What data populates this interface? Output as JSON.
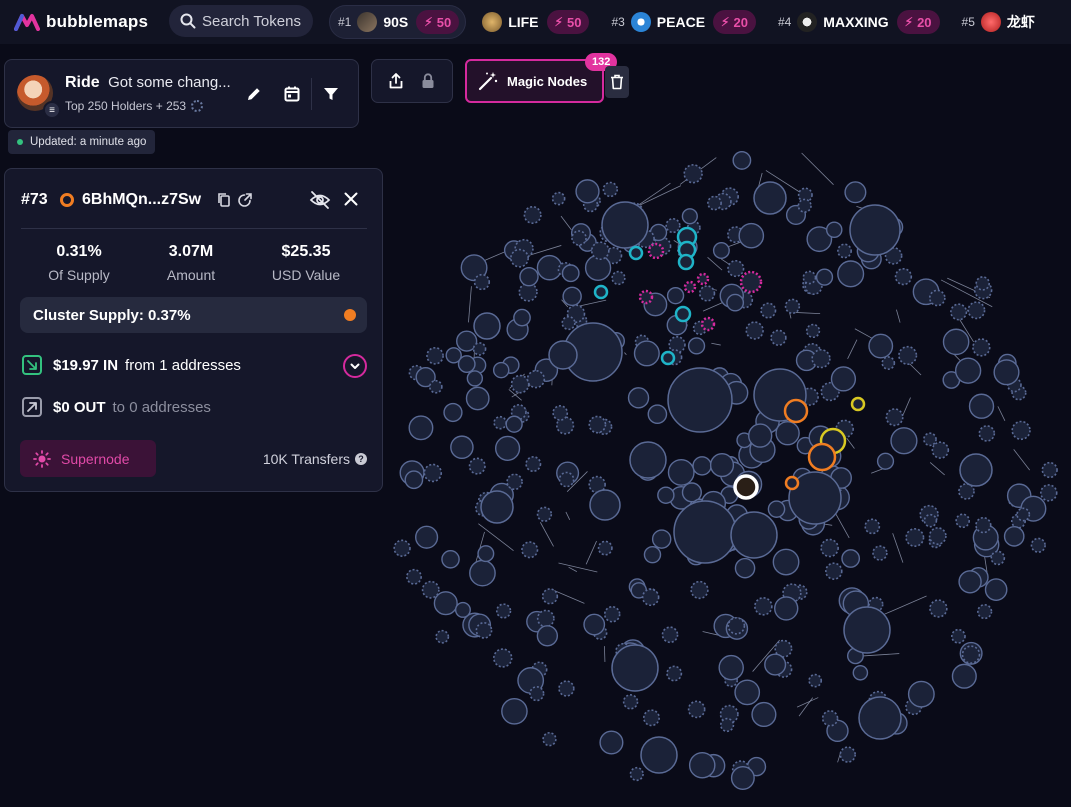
{
  "app": {
    "brand": "bubblemaps",
    "logo_icon": "bubblemaps-logo-icon"
  },
  "search": {
    "placeholder": "Search Tokens"
  },
  "trending": [
    {
      "rank": "#1",
      "symbol": "90S",
      "boost": "50",
      "icon_color": "#6b5a4a"
    },
    {
      "rank": "",
      "symbol": "LIFE",
      "boost": "50",
      "icon_color": "#b08a3a"
    },
    {
      "rank": "#3",
      "symbol": "PEACE",
      "boost": "20",
      "icon_color": "#2b84d6"
    },
    {
      "rank": "#4",
      "symbol": "MAXXING",
      "boost": "20",
      "icon_color": "#d9d9d9"
    },
    {
      "rank": "#5",
      "symbol": "龙虾",
      "boost": "",
      "icon_color": "#d12a2a"
    }
  ],
  "token": {
    "name": "Ride",
    "description": "Got some chang...",
    "subtitle": "Top 250 Holders + 253"
  },
  "updated": {
    "text": "Updated: a minute ago"
  },
  "toolbar": {
    "magic_label": "Magic Nodes",
    "magic_count": "132"
  },
  "holder": {
    "rank": "#73",
    "address": "6BhMQn...z7Sw",
    "stats": [
      {
        "value": "0.31%",
        "label": "Of Supply"
      },
      {
        "value": "3.07M",
        "label": "Amount"
      },
      {
        "value": "$25.35",
        "label": "USD Value"
      }
    ],
    "cluster_supply": "Cluster Supply: 0.37%",
    "inflow": {
      "amount": "$19.97 IN",
      "text": "from 1 addresses"
    },
    "outflow": {
      "amount": "$0 OUT",
      "text": "to 0 addresses"
    },
    "supernode_label": "Supernode",
    "transfers": "10K Transfers"
  },
  "colors": {
    "accent": "#d52a9e",
    "cluster_orange": "#f07d22",
    "inflow_green": "#33c27f",
    "bubble_fill": "#1b2238",
    "bubble_stroke": "#5a6a95",
    "cyan_cluster": "#1fb4c8",
    "magenta_cluster": "#d52a9e",
    "yellow_cluster": "#d9c922"
  }
}
